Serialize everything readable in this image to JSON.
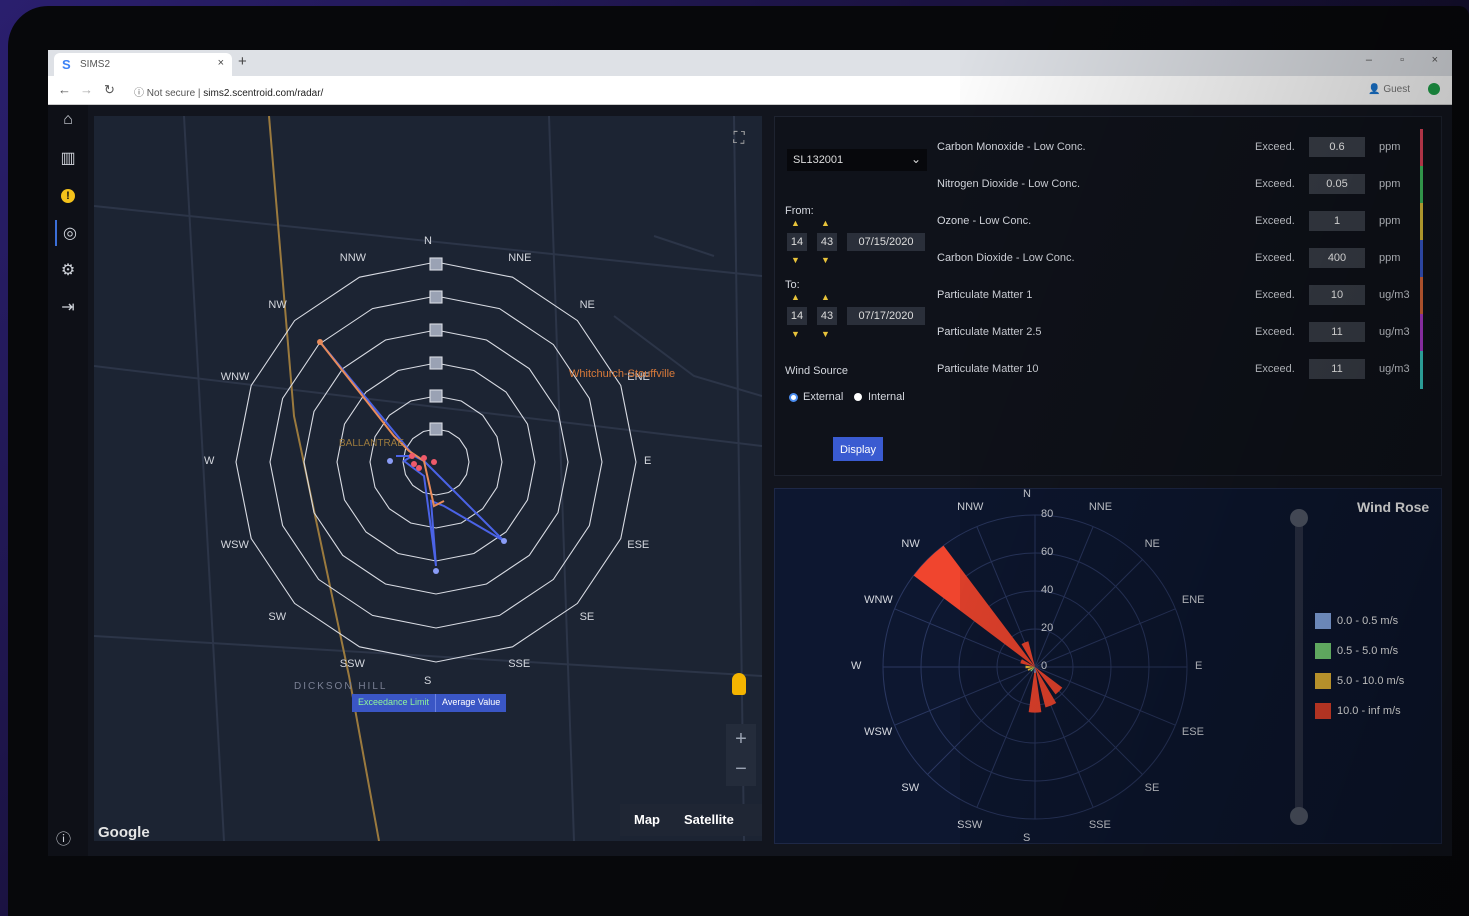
{
  "browser": {
    "tab_title": "SIMS2",
    "tab_favicon": "S",
    "url_security": "Not secure",
    "url": "sims2.scentroid.com/radar/",
    "profile": "Guest"
  },
  "sidebar": {
    "items": [
      {
        "name": "home-icon",
        "glyph": "⌂"
      },
      {
        "name": "chart-icon",
        "glyph": "▥"
      },
      {
        "name": "alert-icon",
        "glyph": "!"
      },
      {
        "name": "radar-icon",
        "glyph": "◎"
      },
      {
        "name": "gear-icon",
        "glyph": "⚙"
      },
      {
        "name": "logout-icon",
        "glyph": "⇥"
      }
    ],
    "help_glyph": "?"
  },
  "map": {
    "directions": [
      "N",
      "NNE",
      "NE",
      "ENE",
      "E",
      "ESE",
      "SE",
      "SSE",
      "S",
      "SSW",
      "SW",
      "WSW",
      "W",
      "WNW",
      "NW",
      "NNW"
    ],
    "place_labels": [
      "Whitchurch-Stouffville",
      "BALLANTRAE",
      "DICKSON HILL"
    ],
    "legend_exceedance": "Exceedance Limit",
    "legend_average": "Average Value",
    "attribution": "Google",
    "maptype_map": "Map",
    "maptype_satellite": "Satellite",
    "zoom_in": "+",
    "zoom_out": "−"
  },
  "settings": {
    "station": "SL132001",
    "from_label": "From:",
    "from_hour": "14",
    "from_minute": "43",
    "from_date": "07/15/2020",
    "to_label": "To:",
    "to_hour": "14",
    "to_minute": "43",
    "to_date": "07/17/2020",
    "wind_source_label": "Wind Source",
    "wind_external": "External",
    "wind_internal": "Internal",
    "display_button": "Display",
    "exceed_label": "Exceed.",
    "pollutants": [
      {
        "name": "Carbon Monoxide - Low Conc.",
        "value": "0.6",
        "unit": "ppm",
        "color": "#e0435a"
      },
      {
        "name": "Nitrogen Dioxide - Low Conc.",
        "value": "0.05",
        "unit": "ppm",
        "color": "#3fbf5f"
      },
      {
        "name": "Ozone - Low Conc.",
        "value": "1",
        "unit": "ppm",
        "color": "#e0c23a"
      },
      {
        "name": "Carbon Dioxide - Low Conc.",
        "value": "400",
        "unit": "ppm",
        "color": "#3a5bd1"
      },
      {
        "name": "Particulate Matter 1",
        "value": "10",
        "unit": "ug/m3",
        "color": "#e06a3a"
      },
      {
        "name": "Particulate Matter 2.5",
        "value": "11",
        "unit": "ug/m3",
        "color": "#b03ad1"
      },
      {
        "name": "Particulate Matter 10",
        "value": "11",
        "unit": "ug/m3",
        "color": "#3ad1c8"
      }
    ]
  },
  "wind_rose": {
    "title": "Wind Rose",
    "directions": [
      "N",
      "NNE",
      "NE",
      "ENE",
      "E",
      "ESE",
      "SE",
      "SSE",
      "S",
      "SSW",
      "SW",
      "WSW",
      "W",
      "WNW",
      "NW",
      "NNW"
    ],
    "radial_ticks": [
      "80",
      "60",
      "40",
      "20",
      "0"
    ],
    "legend": [
      {
        "label": "0.0 - 0.5 m/s",
        "color": "#8fb4f5"
      },
      {
        "label": "0.5 - 5.0 m/s",
        "color": "#7fe07f"
      },
      {
        "label": "5.0 - 10.0 m/s",
        "color": "#f5c23a"
      },
      {
        "label": "10.0 - inf m/s",
        "color": "#f0452e"
      }
    ],
    "petals_10_inf_pct": {
      "NW": 80,
      "NNW": 14,
      "SE": 18,
      "SSE": 22,
      "S": 24,
      "WNW": 8
    }
  }
}
